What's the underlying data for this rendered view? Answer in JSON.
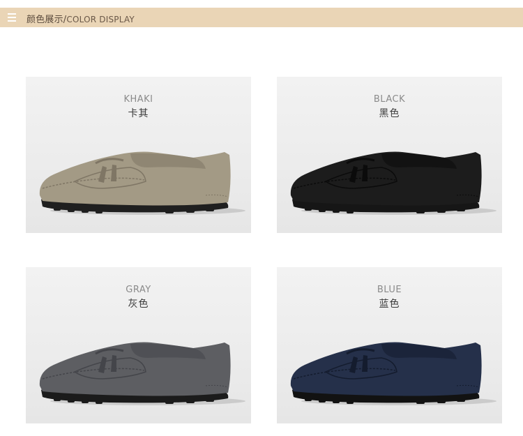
{
  "header": {
    "title_cn": "颜色展示/",
    "title_en": "COLOR DISPLAY",
    "icon": "menu-icon"
  },
  "colors": [
    {
      "en": "KHAKI",
      "cn": "卡其",
      "upper": "#a39a85",
      "shade": "#7f7665",
      "sole": "#1f1f1f"
    },
    {
      "en": "BLACK",
      "cn": "黑色",
      "upper": "#1c1c1c",
      "shade": "#0b0b0b",
      "sole": "#161616"
    },
    {
      "en": "GRAY",
      "cn": "灰色",
      "upper": "#5d5e62",
      "shade": "#44454a",
      "sole": "#1b1b1b"
    },
    {
      "en": "BLUE",
      "cn": "蓝色",
      "upper": "#25304a",
      "shade": "#141c2e",
      "sole": "#121212"
    }
  ]
}
